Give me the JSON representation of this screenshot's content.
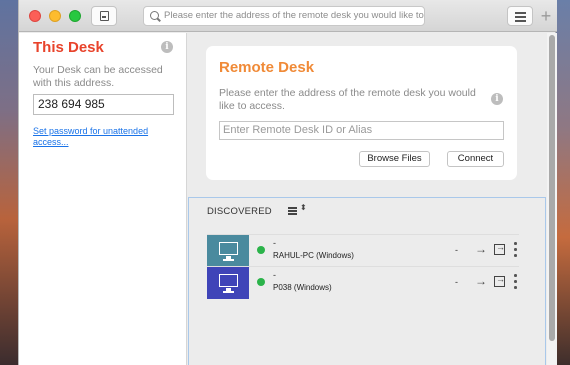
{
  "toolbar": {
    "address_placeholder": "Please enter the address of the remote desk you would like to access.",
    "plus_symbol": "+"
  },
  "this_desk": {
    "title": "This Desk",
    "description": "Your Desk can be accessed with this address.",
    "address": "238 694 985",
    "set_password_link": "Set password for unattended access...",
    "info_symbol": "i"
  },
  "remote_desk": {
    "title": "Remote Desk",
    "description": "Please enter the address of the remote desk you would like to access.",
    "input_placeholder": "Enter Remote Desk ID or Alias",
    "browse_button": "Browse Files",
    "connect_button": "Connect",
    "info_symbol": "i"
  },
  "discovered": {
    "label": "DISCOVERED",
    "sort_symbol": "⬍",
    "devices": [
      {
        "alias": "-",
        "name": "RAHUL-PC (Windows)",
        "status": "online",
        "status_color": "#2bb34a",
        "thumb_color": "#4a8a9e",
        "last": "-",
        "arrow": "→"
      },
      {
        "alias": "-",
        "name": "P038 (Windows)",
        "status": "online",
        "status_color": "#2bb34a",
        "thumb_color": "#3f44b8",
        "last": "-",
        "arrow": "→"
      }
    ]
  },
  "colors": {
    "this_desk_title": "#e8432b",
    "remote_desk_title": "#f08a37",
    "link": "#1a73e8"
  }
}
